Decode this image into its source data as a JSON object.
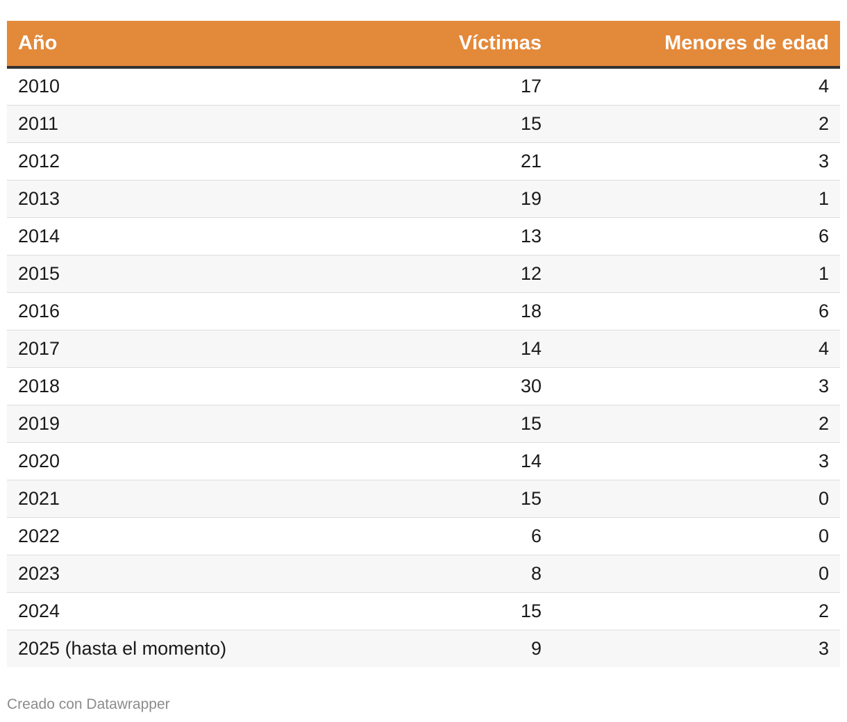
{
  "chart_data": {
    "type": "table",
    "columns": [
      "Año",
      "Víctimas",
      "Menores de edad"
    ],
    "rows": [
      [
        "2010",
        "17",
        "4"
      ],
      [
        "2011",
        "15",
        "2"
      ],
      [
        "2012",
        "21",
        "3"
      ],
      [
        "2013",
        "19",
        "1"
      ],
      [
        "2014",
        "13",
        "6"
      ],
      [
        "2015",
        "12",
        "1"
      ],
      [
        "2016",
        "18",
        "6"
      ],
      [
        "2017",
        "14",
        "4"
      ],
      [
        "2018",
        "30",
        "3"
      ],
      [
        "2019",
        "15",
        "2"
      ],
      [
        "2020",
        "14",
        "3"
      ],
      [
        "2021",
        "15",
        "0"
      ],
      [
        "2022",
        "6",
        "0"
      ],
      [
        "2023",
        "8",
        "0"
      ],
      [
        "2024",
        "15",
        "2"
      ],
      [
        "2025 (hasta el momento)",
        "9",
        "3"
      ]
    ]
  },
  "footer": {
    "credit": "Creado con Datawrapper"
  },
  "colors": {
    "header_bg": "#e3893a",
    "header_text": "#ffffff",
    "header_rule": "#333333",
    "stripe": "#f7f7f7"
  }
}
